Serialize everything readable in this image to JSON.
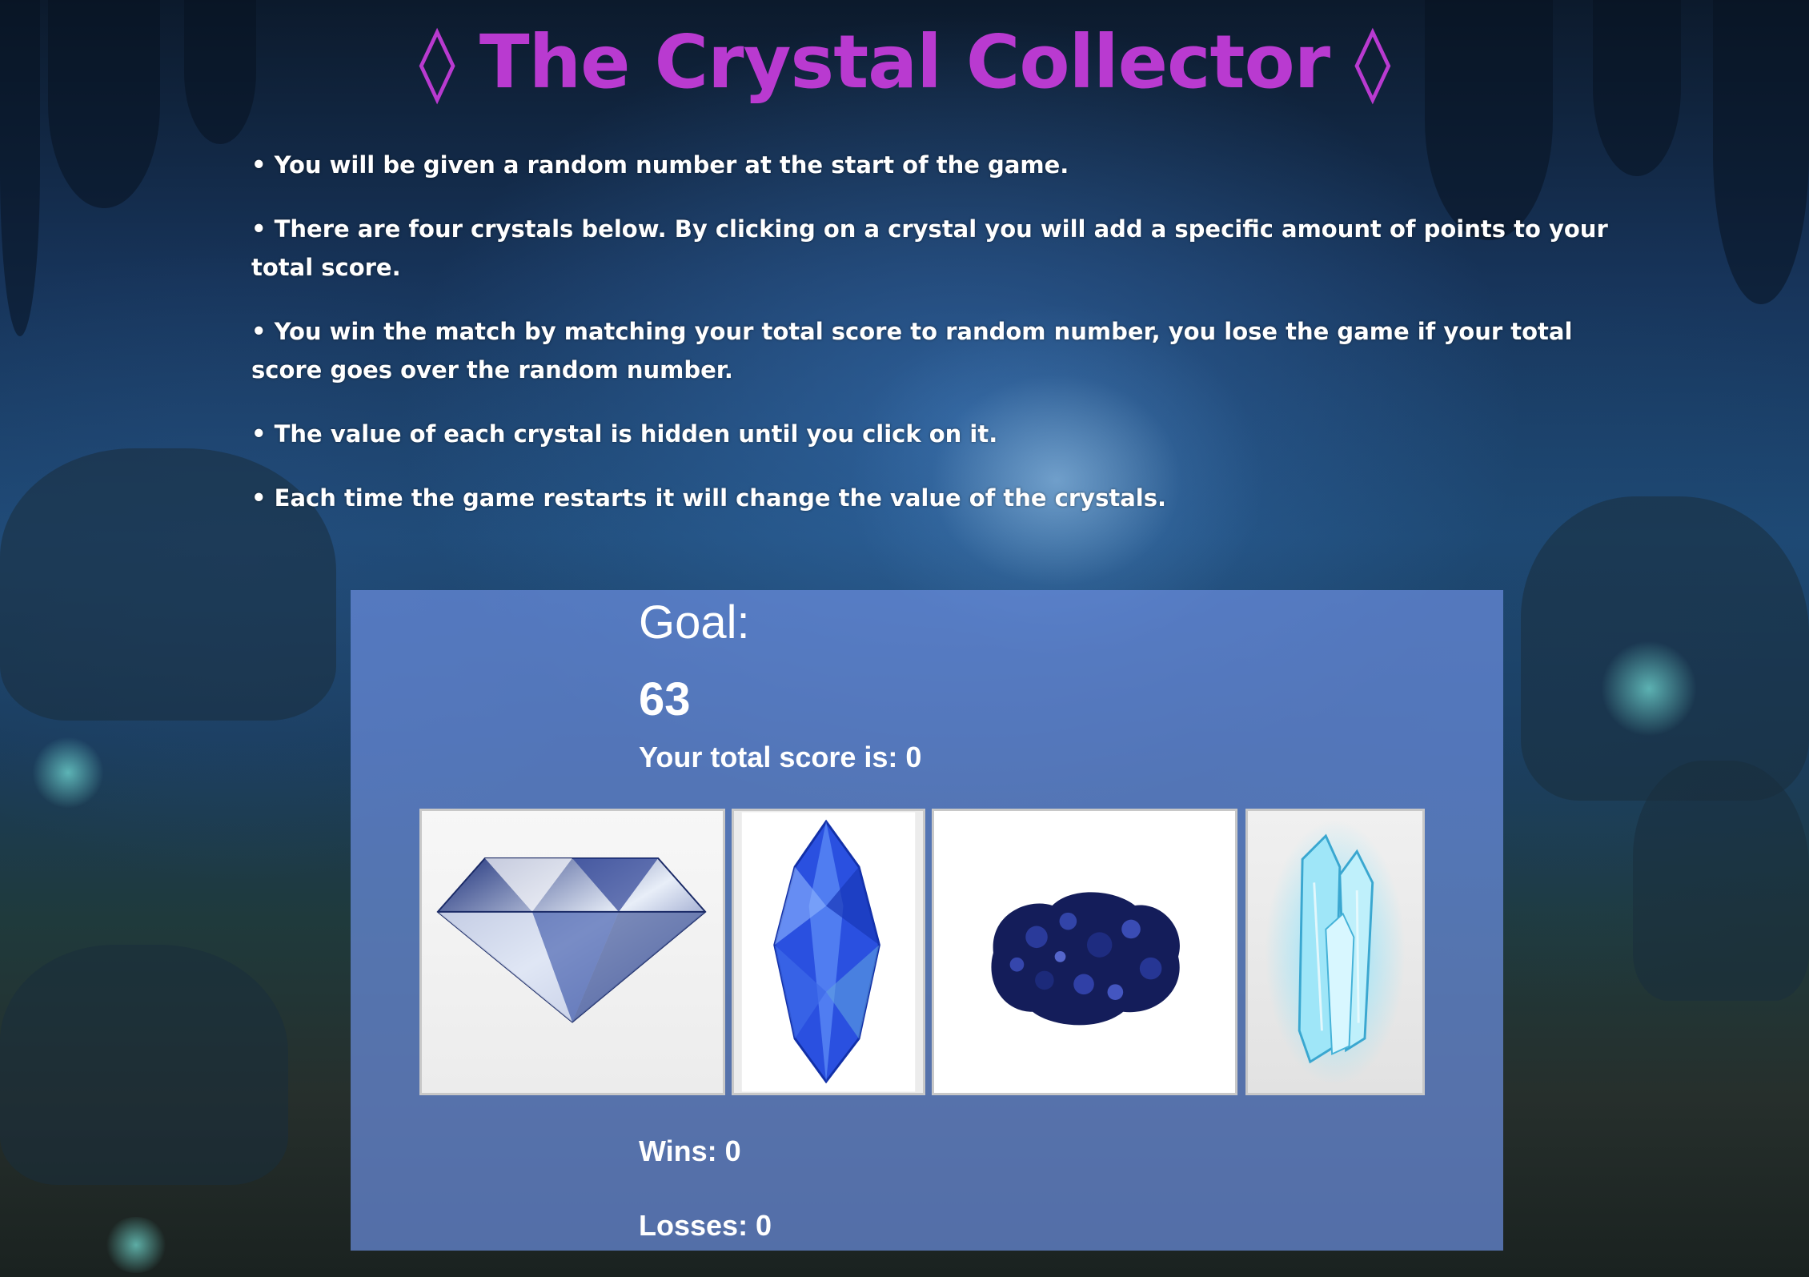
{
  "title": "◊ The Crystal Collector ◊",
  "instructions": [
    "• You will be given a random number at the start of the game.",
    "• There are four crystals below. By clicking on a crystal you will add a specific amount of points to your total score.",
    "• You win the match by matching your total score to random number, you lose the game if your total score goes over the random number.",
    "• The value of each crystal is hidden until you click on it.",
    "• Each time the game restarts it will change the value of the crystals."
  ],
  "game": {
    "goal_label": "Goal:",
    "goal_value": "63",
    "score_text": "Your total score is: 0",
    "wins_text": "Wins: 0",
    "losses_text": "Losses: 0"
  },
  "crystals": [
    {
      "icon": "diamond-icon"
    },
    {
      "icon": "blue-crystal-icon"
    },
    {
      "icon": "azurite-rock-icon"
    },
    {
      "icon": "ice-crystal-icon"
    }
  ],
  "colors": {
    "title": "#b93ad0",
    "panel": "#698cdc"
  }
}
